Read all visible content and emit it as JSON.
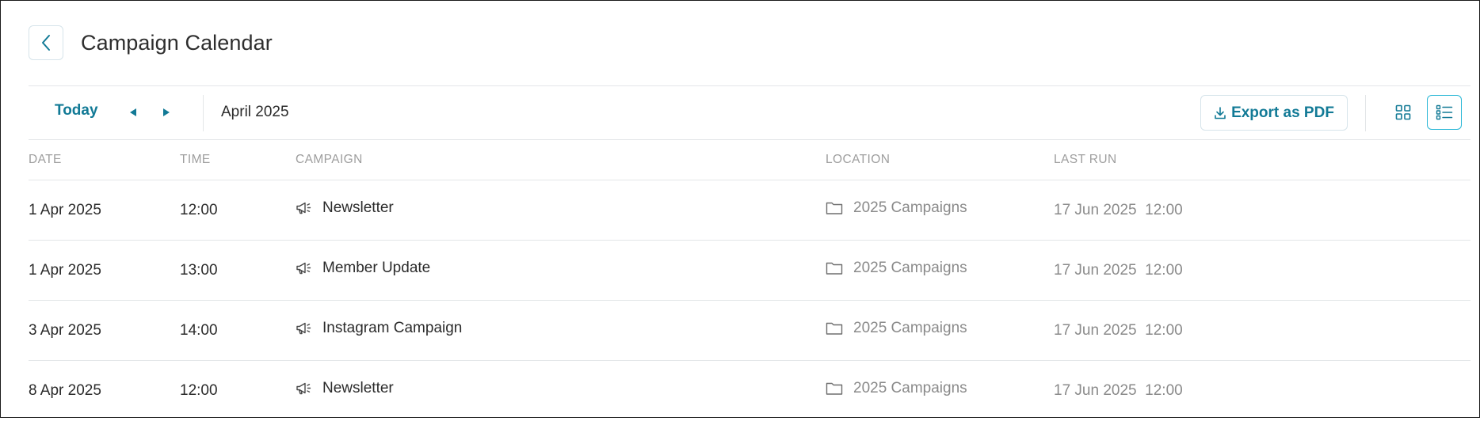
{
  "header": {
    "title": "Campaign Calendar",
    "back_icon": "chevron-left-icon"
  },
  "toolbar": {
    "today_label": "Today",
    "prev_icon": "caret-left-icon",
    "next_icon": "caret-right-icon",
    "month_label": "April 2025",
    "export_label": "Export as PDF",
    "export_icon": "download-icon",
    "grid_view_icon": "grid-view-icon",
    "list_view_icon": "list-view-icon",
    "active_view": "list"
  },
  "table": {
    "columns": [
      "DATE",
      "TIME",
      "CAMPAIGN",
      "LOCATION",
      "LAST RUN"
    ],
    "rows": [
      {
        "date": "1 Apr 2025",
        "time": "12:00",
        "campaign": "Newsletter",
        "location": "2025 Campaigns",
        "last_run": "17 Jun 2025  12:00"
      },
      {
        "date": "1 Apr 2025",
        "time": "13:00",
        "campaign": "Member Update",
        "location": "2025 Campaigns",
        "last_run": "17 Jun 2025  12:00"
      },
      {
        "date": "3 Apr 2025",
        "time": "14:00",
        "campaign": "Instagram Campaign",
        "location": "2025 Campaigns",
        "last_run": "17 Jun 2025  12:00"
      },
      {
        "date": "8 Apr 2025",
        "time": "12:00",
        "campaign": "Newsletter",
        "location": "2025 Campaigns",
        "last_run": "17 Jun 2025  12:00"
      }
    ],
    "campaign_icon": "megaphone-icon",
    "location_icon": "folder-icon"
  },
  "colors": {
    "accent": "#127a96",
    "active_border": "#29b7d6",
    "muted_text": "#8a8a8a",
    "header_text": "#9e9e9e",
    "divider": "#e3e6e8"
  }
}
